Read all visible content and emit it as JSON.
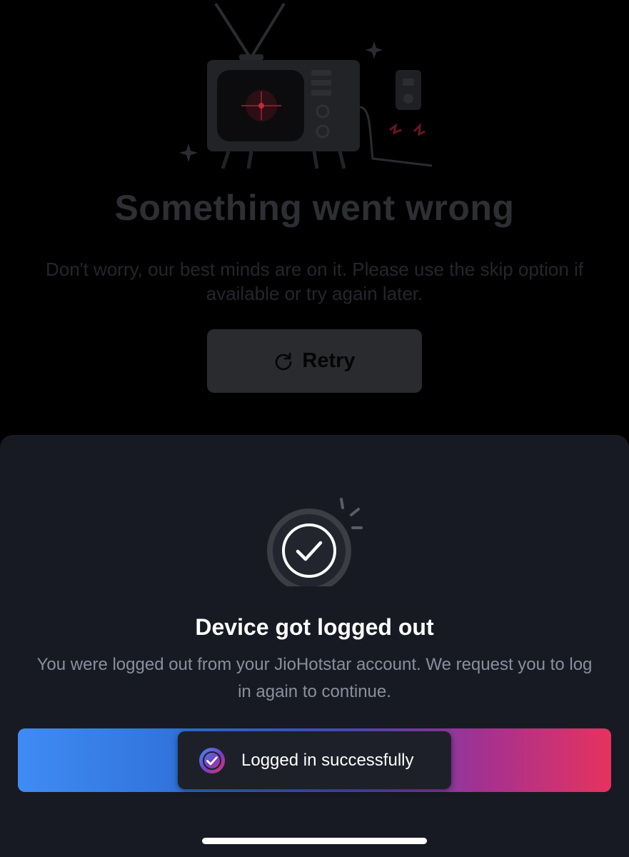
{
  "error_page": {
    "title": "Something went wrong",
    "message": "Don't worry, our best minds are on it. Please use the skip option if available or try again later.",
    "retry_label": "Retry",
    "illustration_icon": "broken-tv-icon",
    "retry_icon": "refresh-icon"
  },
  "sheet": {
    "status_icon": "check-circle-icon",
    "title": "Device got logged out",
    "message": "You were logged out from your JioHotstar account. We request you to log in again to continue.",
    "button_gradient": [
      "#3f8cf4",
      "#a33191",
      "#e6325f"
    ],
    "toast": {
      "label": "Logged in successfully",
      "icon": "check-badge-icon"
    }
  },
  "colors": {
    "background": "#000000",
    "sheet_background": "#181a23",
    "accent_blue": "#3f8cf4",
    "accent_pink": "#e6325f"
  }
}
